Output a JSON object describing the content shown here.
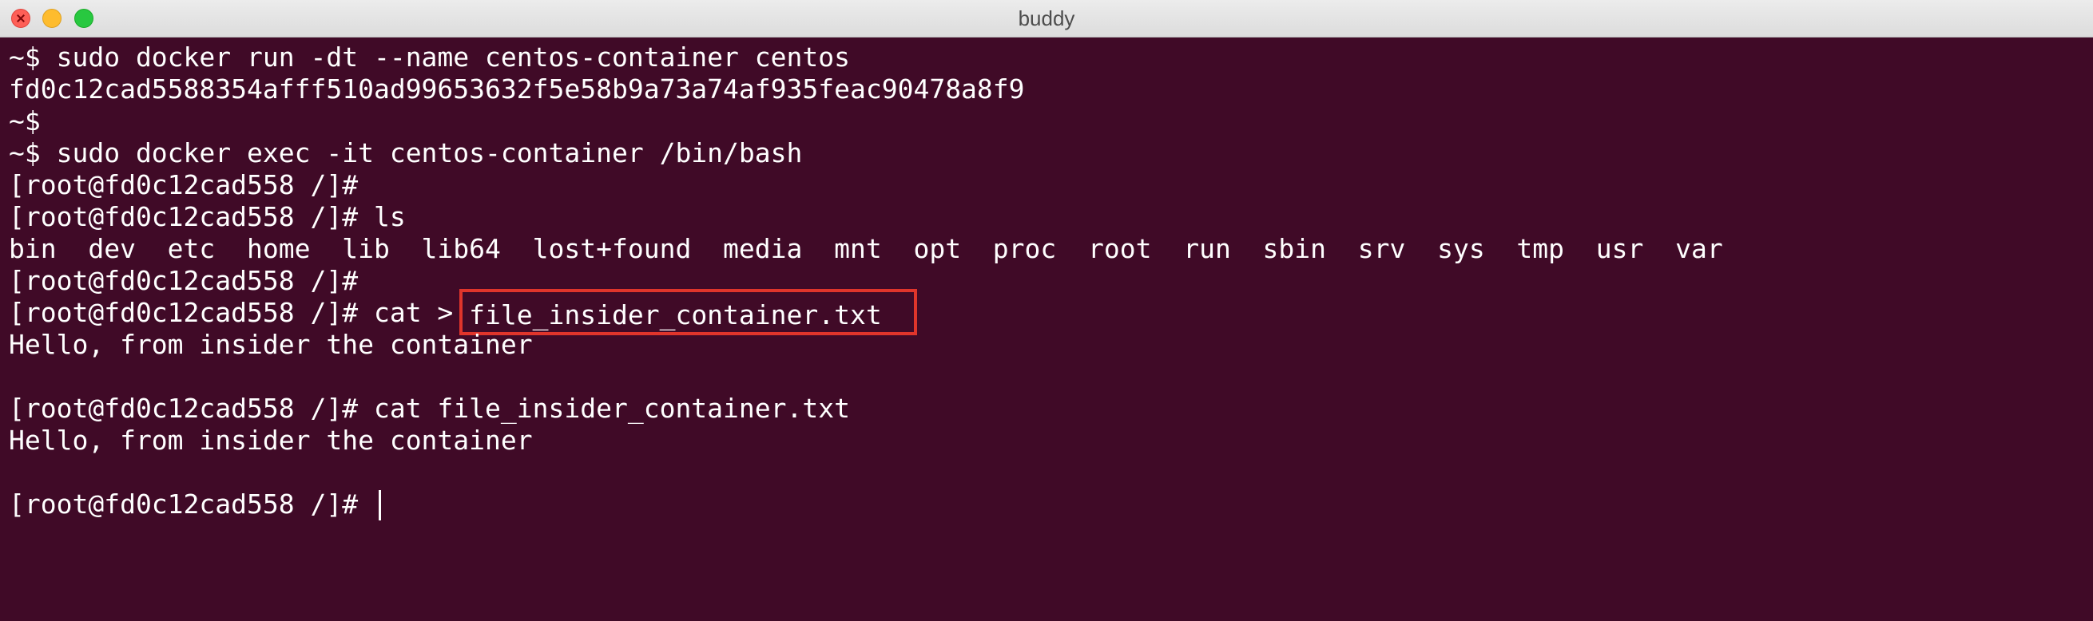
{
  "window": {
    "title": "buddy"
  },
  "terminal": {
    "lines": [
      "~$ sudo docker run -dt --name centos-container centos",
      "fd0c12cad5588354afff510ad99653632f5e58b9a73a74af935feac90478a8f9",
      "~$",
      "~$ sudo docker exec -it centos-container /bin/bash",
      "[root@fd0c12cad558 /]#",
      "[root@fd0c12cad558 /]# ls",
      "bin  dev  etc  home  lib  lib64  lost+found  media  mnt  opt  proc  root  run  sbin  srv  sys  tmp  usr  var",
      "[root@fd0c12cad558 /]#",
      "",
      "Hello, from insider the container",
      "",
      "[root@fd0c12cad558 /]# cat file_insider_container.txt",
      "Hello, from insider the container",
      "",
      ""
    ],
    "highlight_line": {
      "prefix": "[root@fd0c12cad558 /]# cat > ",
      "highlighted": "file_insider_container.txt"
    },
    "prompt": "[root@fd0c12cad558 /]# "
  },
  "colors": {
    "background": "#400a27",
    "text": "#ffffff",
    "highlight_box": "#e0352b"
  }
}
